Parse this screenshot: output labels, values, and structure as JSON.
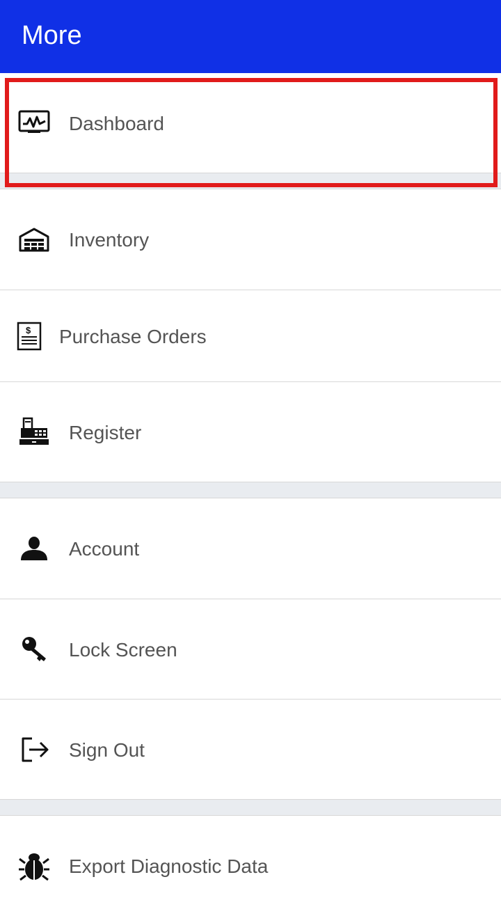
{
  "app_bar": {
    "title": "More"
  },
  "menu": {
    "dashboard": "Dashboard",
    "inventory": "Inventory",
    "purchase_orders": "Purchase Orders",
    "register": "Register",
    "account": "Account",
    "lock_screen": "Lock Screen",
    "sign_out": "Sign Out",
    "export_diagnostic": "Export Diagnostic Data"
  },
  "colors": {
    "app_bar": "#1030e6",
    "highlight": "#e11b1b",
    "section_gap": "#e9ecf0",
    "label_text": "#545454"
  },
  "icons": {
    "dashboard": "activity-chart-icon",
    "inventory": "warehouse-icon",
    "purchase_orders": "invoice-icon",
    "register": "cash-register-icon",
    "account": "user-icon",
    "lock_screen": "key-icon",
    "sign_out": "sign-out-icon",
    "export_diagnostic": "bug-icon"
  }
}
